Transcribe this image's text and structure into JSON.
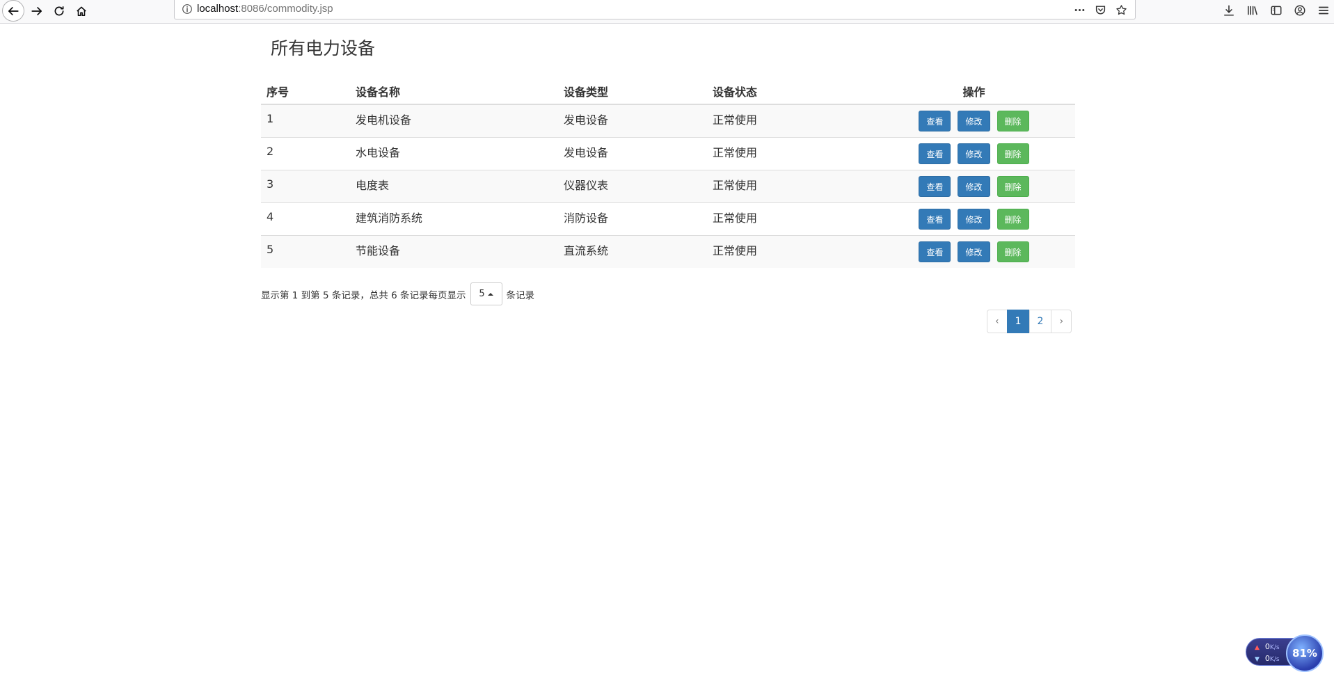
{
  "browser": {
    "url_host": "localhost",
    "url_rest": ":8086/commodity.jsp"
  },
  "page": {
    "title": "所有电力设备"
  },
  "table": {
    "headers": {
      "index": "序号",
      "name": "设备名称",
      "type": "设备类型",
      "status": "设备状态",
      "ops": "操作"
    },
    "rows": [
      {
        "index": "1",
        "name": "发电机设备",
        "type": "发电设备",
        "status": "正常使用"
      },
      {
        "index": "2",
        "name": "水电设备",
        "type": "发电设备",
        "status": "正常使用"
      },
      {
        "index": "3",
        "name": "电度表",
        "type": "仪器仪表",
        "status": "正常使用"
      },
      {
        "index": "4",
        "name": "建筑消防系统",
        "type": "消防设备",
        "status": "正常使用"
      },
      {
        "index": "5",
        "name": "节能设备",
        "type": "直流系统",
        "status": "正常使用"
      }
    ],
    "buttons": {
      "view": "查看",
      "edit": "修改",
      "delete": "删除"
    }
  },
  "pager": {
    "info_prefix": "显示第 1 到第 5 条记录，总共 6 条记录每页显示",
    "page_size": "5",
    "info_suffix": "条记录",
    "prev": "‹",
    "pages": [
      "1",
      "2"
    ],
    "active_page": "1",
    "next": "›"
  },
  "speed_widget": {
    "up_value": "0",
    "up_unit": "K/s",
    "down_value": "0",
    "down_unit": "K/s",
    "percent": "81%"
  },
  "colors": {
    "primary": "#337ab7",
    "success": "#5cb85c"
  }
}
